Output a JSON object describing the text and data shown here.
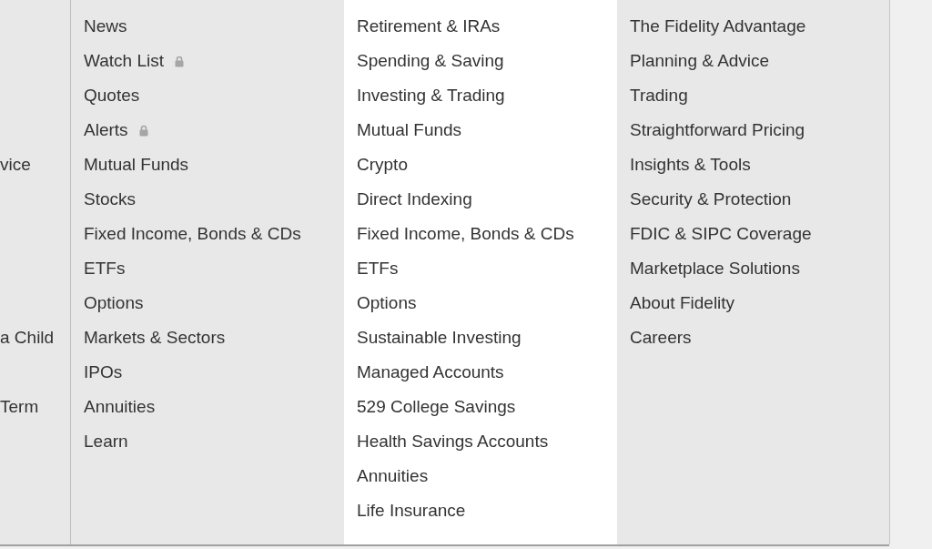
{
  "columns": [
    {
      "items": [
        {
          "text": "vice"
        },
        {
          "text": "a Child"
        },
        {
          "text": "Term"
        }
      ]
    },
    {
      "items": [
        {
          "text": "News",
          "locked": false
        },
        {
          "text": "Watch List",
          "locked": true
        },
        {
          "text": "Quotes",
          "locked": false
        },
        {
          "text": "Alerts",
          "locked": true
        },
        {
          "text": "Mutual Funds",
          "locked": false
        },
        {
          "text": "Stocks",
          "locked": false
        },
        {
          "text": "Fixed Income, Bonds & CDs",
          "locked": false
        },
        {
          "text": "ETFs",
          "locked": false
        },
        {
          "text": "Options",
          "locked": false
        },
        {
          "text": "Markets & Sectors",
          "locked": false
        },
        {
          "text": "IPOs",
          "locked": false
        },
        {
          "text": "Annuities",
          "locked": false
        },
        {
          "text": "Learn",
          "locked": false
        }
      ]
    },
    {
      "items": [
        {
          "text": "Retirement & IRAs"
        },
        {
          "text": "Spending & Saving"
        },
        {
          "text": "Investing & Trading"
        },
        {
          "text": "Mutual Funds"
        },
        {
          "text": "Crypto"
        },
        {
          "text": "Direct Indexing"
        },
        {
          "text": "Fixed Income, Bonds & CDs"
        },
        {
          "text": "ETFs"
        },
        {
          "text": "Options"
        },
        {
          "text": "Sustainable Investing"
        },
        {
          "text": "Managed Accounts"
        },
        {
          "text": "529 College Savings"
        },
        {
          "text": "Health Savings Accounts"
        },
        {
          "text": "Annuities"
        },
        {
          "text": "Life Insurance"
        }
      ]
    },
    {
      "items": [
        {
          "text": "The Fidelity Advantage"
        },
        {
          "text": "Planning & Advice"
        },
        {
          "text": "Trading"
        },
        {
          "text": "Straightforward Pricing"
        },
        {
          "text": "Insights & Tools"
        },
        {
          "text": "Security & Protection"
        },
        {
          "text": "FDIC & SIPC Coverage"
        },
        {
          "text": "Marketplace Solutions"
        },
        {
          "text": "About Fidelity"
        },
        {
          "text": "Careers"
        }
      ]
    }
  ]
}
